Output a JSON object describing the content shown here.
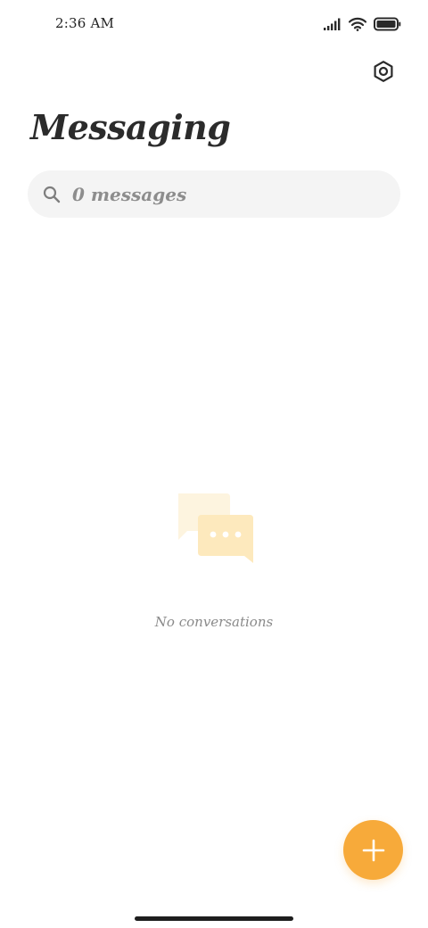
{
  "status_bar": {
    "time": "2:36 AM",
    "icons": [
      "signal-icon",
      "wifi-icon",
      "battery-icon"
    ]
  },
  "header": {
    "title": "Messaging",
    "settings_icon": "settings-hexagon-icon"
  },
  "search": {
    "placeholder": "0 messages",
    "icon": "search-icon"
  },
  "empty_state": {
    "icon": "chat-bubbles-icon",
    "message": "No conversations"
  },
  "fab": {
    "icon": "plus-icon"
  },
  "colors": {
    "accent": "#f7aa3a",
    "title": "#2b2b2b",
    "search_bg": "#f4f4f4",
    "muted_text": "#8a8a8a",
    "illustration_light": "#fdf4df",
    "illustration_dark": "#fde9bd"
  }
}
